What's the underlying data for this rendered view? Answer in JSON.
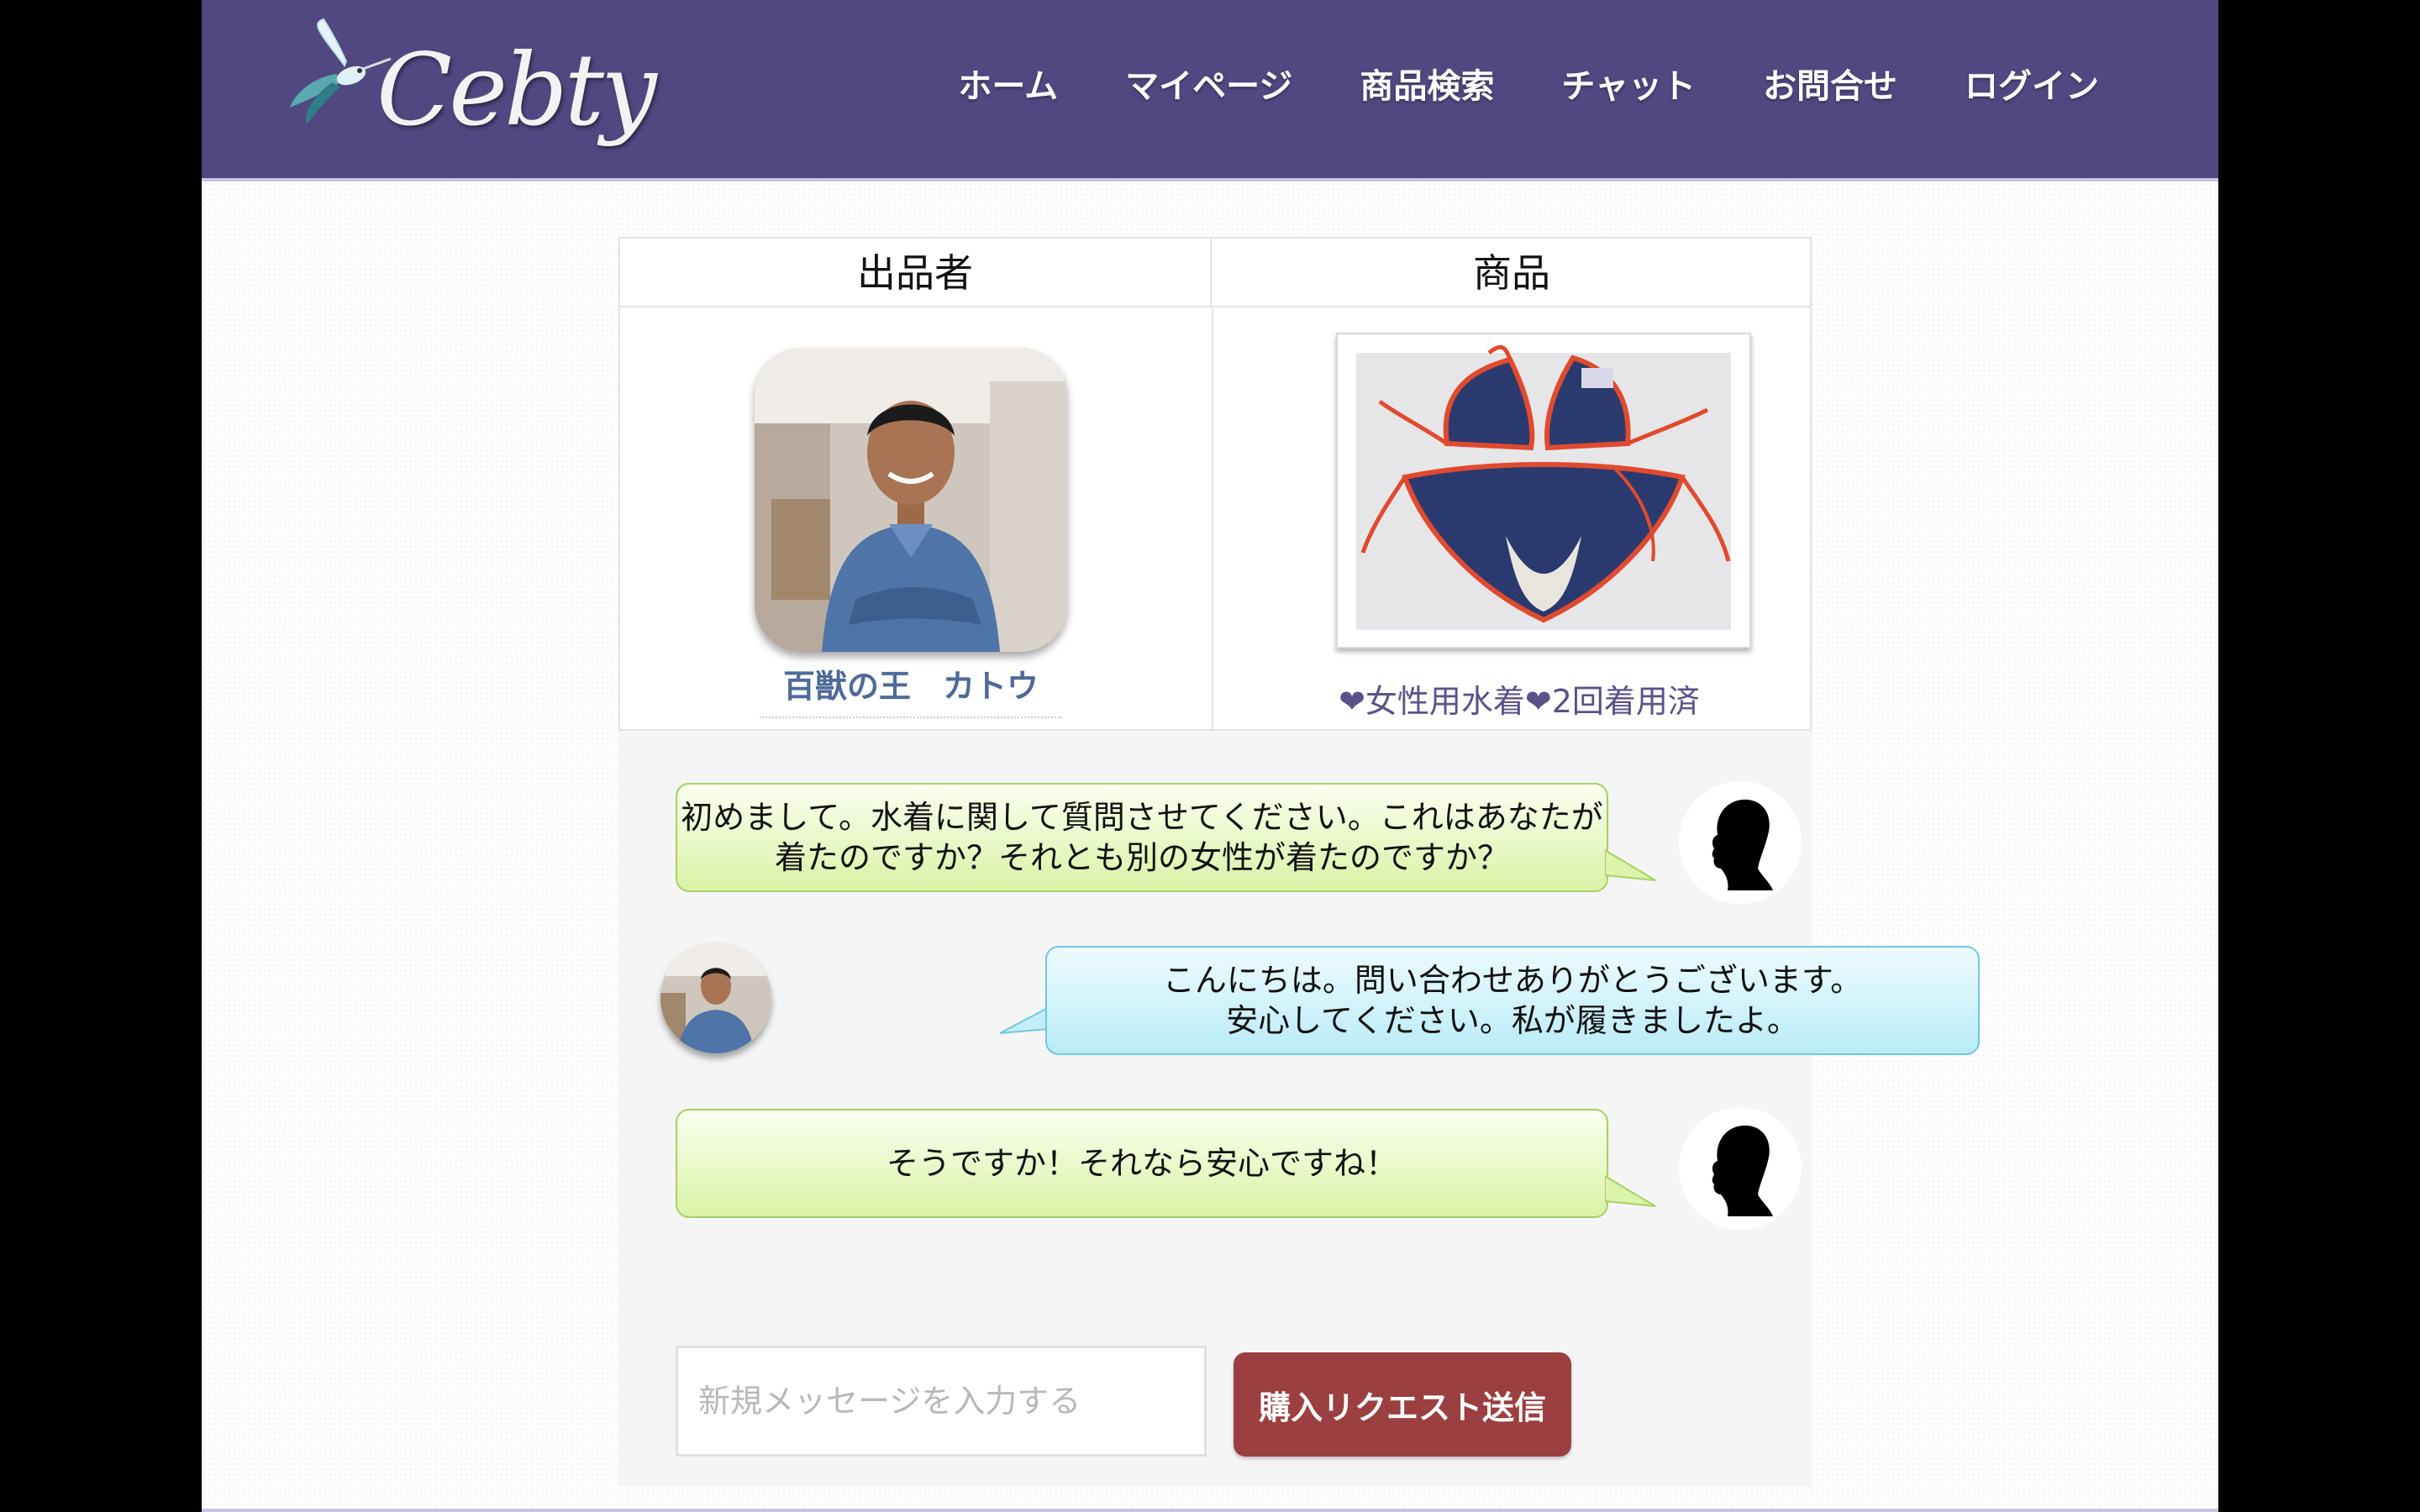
{
  "header": {
    "logo_text": "Cebty",
    "nav": [
      "ホーム",
      "マイページ",
      "商品検索",
      "チャット",
      "お問合せ",
      "ログイン"
    ]
  },
  "table": {
    "seller_header": "出品者",
    "item_header": "商品",
    "seller_name": "百獣の王　カトウ",
    "item_title": "❤女性用水着❤2回着用済"
  },
  "chat": {
    "messages": [
      {
        "from": "buyer",
        "lines": [
          "初めまして。水着に関して質問させてください。これはあなたが",
          "着たのですか？それとも別の女性が着たのですか？"
        ]
      },
      {
        "from": "seller",
        "lines": [
          "こんにちは。問い合わせありがとうございます。",
          "安心してください。私が履きましたよ。"
        ]
      },
      {
        "from": "buyer",
        "lines": [
          "そうですか！それなら安心ですね！"
        ]
      }
    ]
  },
  "composer": {
    "placeholder": "新規メッセージを入力する",
    "send_label": "購入リクエスト送信"
  },
  "colors": {
    "header_bg": "#514881",
    "buyer_bubble": "#d9f2a6",
    "seller_bubble": "#b9ebf7",
    "send_button": "#9b3f41"
  }
}
